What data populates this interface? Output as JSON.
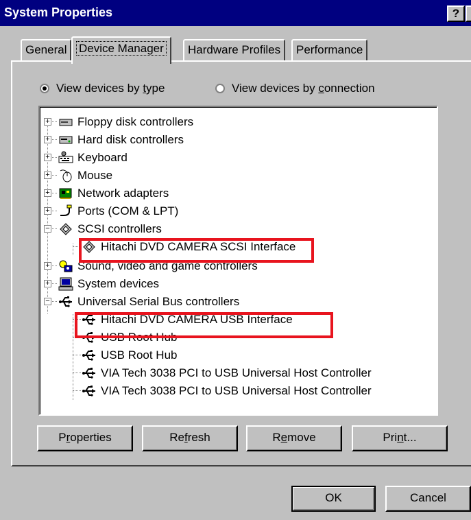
{
  "window": {
    "title": "System Properties",
    "help_label": "?",
    "close_label": "×"
  },
  "tabs": [
    {
      "label": "General",
      "active": false
    },
    {
      "label": "Device Manager",
      "active": true
    },
    {
      "label": "Hardware Profiles",
      "active": false
    },
    {
      "label": "Performance",
      "active": false
    }
  ],
  "view": {
    "by_type": {
      "pre": "View devices by ",
      "accel": "t",
      "post": "ype",
      "selected": true
    },
    "by_connection": {
      "pre": "View devices by ",
      "accel": "c",
      "post": "onnection",
      "selected": false
    }
  },
  "tree": {
    "items": [
      {
        "label": "Floppy disk controllers",
        "icon": "floppy-controller-icon",
        "expander": "+"
      },
      {
        "label": "Hard disk controllers",
        "icon": "hard-disk-controller-icon",
        "expander": "+"
      },
      {
        "label": "Keyboard",
        "icon": "keyboard-icon",
        "expander": "+"
      },
      {
        "label": "Mouse",
        "icon": "mouse-icon",
        "expander": "+"
      },
      {
        "label": "Network adapters",
        "icon": "network-adapter-icon",
        "expander": "+"
      },
      {
        "label": "Ports (COM & LPT)",
        "icon": "port-icon",
        "expander": "+"
      },
      {
        "label": "SCSI controllers",
        "icon": "scsi-icon",
        "expander": "−"
      },
      {
        "label": "Hitachi DVD CAMERA SCSI Interface",
        "icon": "scsi-icon",
        "child": true
      },
      {
        "label": "Sound, video and game controllers",
        "icon": "sound-video-icon",
        "expander": "+"
      },
      {
        "label": "System devices",
        "icon": "computer-icon",
        "expander": "+"
      },
      {
        "label": "Universal Serial Bus controllers",
        "icon": "usb-icon",
        "expander": "−"
      },
      {
        "label": "Hitachi DVD CAMERA USB Interface",
        "icon": "usb-icon",
        "child": true
      },
      {
        "label": "USB Root Hub",
        "icon": "usb-icon",
        "child": true
      },
      {
        "label": "USB Root Hub",
        "icon": "usb-icon",
        "child": true
      },
      {
        "label": "VIA Tech 3038 PCI to USB Universal Host Controller",
        "icon": "usb-icon",
        "child": true
      },
      {
        "label": "VIA Tech 3038 PCI to USB Universal Host Controller",
        "icon": "usb-icon",
        "child": true
      }
    ]
  },
  "buttons": {
    "properties": {
      "pre": "P",
      "accel": "r",
      "post": "operties"
    },
    "refresh": {
      "pre": "Re",
      "accel": "f",
      "post": "resh"
    },
    "remove": {
      "pre": "R",
      "accel": "e",
      "post": "move"
    },
    "print": {
      "pre": "Pri",
      "accel": "n",
      "post": "t..."
    },
    "ok": "OK",
    "cancel": "Cancel"
  },
  "colors": {
    "titlebar": "#000080",
    "face": "#c0c0c0",
    "highlight_box": "#e8141e"
  }
}
